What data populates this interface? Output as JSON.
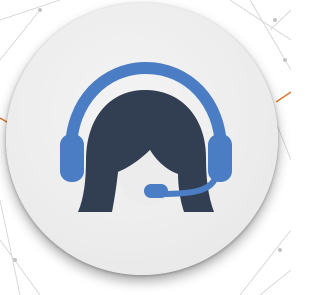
{
  "badge": {
    "icon": "customer-support-headset-icon",
    "colors": {
      "headset": "#4a7dc4",
      "figure": "#323e52",
      "face": "#ececec",
      "circle": "#ececec",
      "network_lines": "#c9c9c9",
      "accent_line": "#e2772d"
    }
  }
}
